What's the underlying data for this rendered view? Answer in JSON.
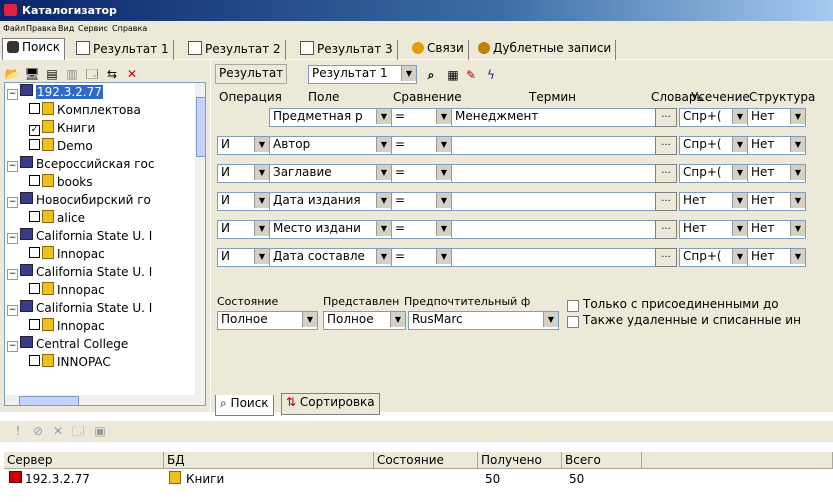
{
  "app": {
    "title": "Каталогизатор"
  },
  "menu": [
    "Файл",
    "Правка",
    "Вид",
    "Сервис",
    "Справка"
  ],
  "tabs": [
    {
      "label": "Поиск",
      "active": true
    },
    {
      "label": "Результат 1"
    },
    {
      "label": "Результат 2"
    },
    {
      "label": "Результат 3"
    },
    {
      "label": "Связи"
    },
    {
      "label": "Дублетные записи"
    }
  ],
  "tree": {
    "items": [
      {
        "label": "192.3.2.77",
        "level": 0,
        "type": "server",
        "expanded": true,
        "selected": true
      },
      {
        "label": "Комплектова",
        "level": 1,
        "type": "db",
        "checked": false
      },
      {
        "label": "Книги",
        "level": 1,
        "type": "db",
        "checked": true
      },
      {
        "label": "Demo",
        "level": 1,
        "type": "db",
        "checked": false
      },
      {
        "label": "Всероссийская гос",
        "level": 0,
        "type": "server",
        "expanded": true
      },
      {
        "label": "books",
        "level": 1,
        "type": "db",
        "checked": false
      },
      {
        "label": "Новосибирский го",
        "level": 0,
        "type": "server",
        "expanded": true
      },
      {
        "label": "alice",
        "level": 1,
        "type": "db",
        "checked": false
      },
      {
        "label": "California State U. I",
        "level": 0,
        "type": "server",
        "expanded": true
      },
      {
        "label": "Innopac",
        "level": 1,
        "type": "db",
        "checked": false
      },
      {
        "label": "California State U. I",
        "level": 0,
        "type": "server",
        "expanded": true
      },
      {
        "label": "Innopac",
        "level": 1,
        "type": "db",
        "checked": false
      },
      {
        "label": "California State U. I",
        "level": 0,
        "type": "server",
        "expanded": true
      },
      {
        "label": "Innopac",
        "level": 1,
        "type": "db",
        "checked": false
      },
      {
        "label": "Central College",
        "level": 0,
        "type": "server",
        "expanded": true
      },
      {
        "label": "INNOPAC",
        "level": 1,
        "type": "db",
        "checked": false
      }
    ]
  },
  "result_toolbar": {
    "label": "Результат",
    "selected": "Результат 1"
  },
  "headers": {
    "op": "Операция",
    "field": "Поле",
    "cmp": "Сравнение",
    "term": "Термин",
    "dict": "Словарь",
    "trunc": "Усечение",
    "struct": "Структура"
  },
  "rows": [
    {
      "op": "",
      "field": "Предметная р",
      "cmp": "=",
      "term": "Менеджмент",
      "trunc": "Спр+(",
      "struct": "Нет"
    },
    {
      "op": "И",
      "field": "Автор",
      "cmp": "=",
      "term": "",
      "trunc": "Спр+(",
      "struct": "Нет"
    },
    {
      "op": "И",
      "field": "Заглавие",
      "cmp": "=",
      "term": "",
      "trunc": "Спр+(",
      "struct": "Нет"
    },
    {
      "op": "И",
      "field": "Дата издания",
      "cmp": "=",
      "term": "",
      "trunc": "Нет",
      "struct": "Нет"
    },
    {
      "op": "И",
      "field": "Место издани",
      "cmp": "=",
      "term": "",
      "trunc": "Нет",
      "struct": "Нет"
    },
    {
      "op": "И",
      "field": "Дата составле",
      "cmp": "=",
      "term": "",
      "trunc": "Спр+(",
      "struct": "Нет"
    }
  ],
  "options": {
    "state_label": "Состояние",
    "state_value": "Полное",
    "repr_label": "Представлен",
    "repr_value": "Полное",
    "pref_label": "Предпочтительный ф",
    "pref_value": "RusMarc",
    "only_linked": "Только с присоединенными до",
    "also_deleted": "Также удаленные и списанные ин"
  },
  "bottom_tabs": [
    {
      "label": "Поиск",
      "active": true
    },
    {
      "label": "Сортировка"
    }
  ],
  "results_table": {
    "columns": [
      "Сервер",
      "БД",
      "Состояние",
      "Получено",
      "Всего"
    ],
    "rows": [
      {
        "server": "192.3.2.77",
        "db": "Книги",
        "state": "",
        "received": "50",
        "total": "50"
      }
    ]
  }
}
